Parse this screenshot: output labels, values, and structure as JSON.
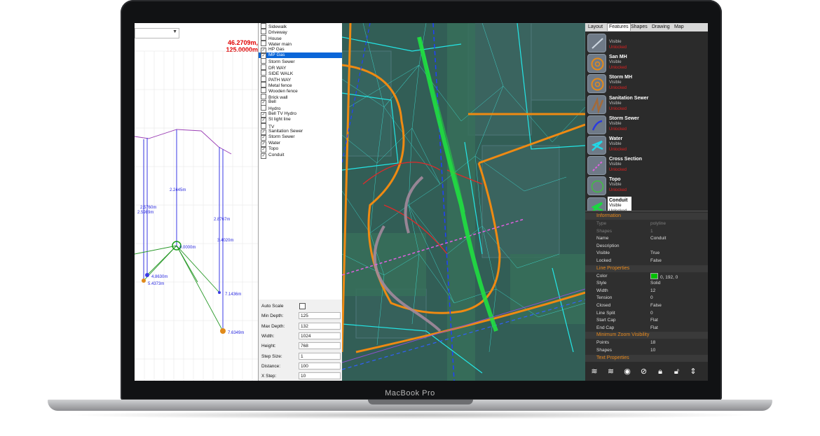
{
  "device": {
    "label": "MacBook Pro"
  },
  "profile": {
    "coords": "46.2709m, 125.0000m",
    "labels": {
      "top_span": "2.2445m",
      "left_a": "2.5760m",
      "left_b": "2.5989m",
      "right_a": "2.8767m",
      "right_b": "3.4020m",
      "center": "0.0000m",
      "low_left_a": "4.8630m",
      "low_left_b": "5.4373m",
      "low_right_a": "7.1436m",
      "low_right_b": "7.6349m"
    }
  },
  "layers": [
    {
      "label": "Sidewalk",
      "checked": false
    },
    {
      "label": "Driveway",
      "checked": false
    },
    {
      "label": "House",
      "checked": false
    },
    {
      "label": "Water main",
      "checked": false
    },
    {
      "label": "HP Gas",
      "checked": true
    },
    {
      "label": "MP Gas",
      "checked": true,
      "selected": true
    },
    {
      "label": "Storm Sewer",
      "checked": false
    },
    {
      "label": "DR WAY",
      "checked": false
    },
    {
      "label": "SIDE WALK",
      "checked": false
    },
    {
      "label": "PATH WAY",
      "checked": false
    },
    {
      "label": "Metal fence",
      "checked": false
    },
    {
      "label": "Wooden fence",
      "checked": false
    },
    {
      "label": "Brick wall",
      "checked": false
    },
    {
      "label": "Bell",
      "checked": true
    },
    {
      "label": "Hydro",
      "checked": false
    },
    {
      "label": "Bell TV Hydro",
      "checked": true
    },
    {
      "label": "St light line",
      "checked": true
    },
    {
      "label": "TV",
      "checked": false
    },
    {
      "label": "Sanitation Sewer",
      "checked": true
    },
    {
      "label": "Storm Sewer",
      "checked": true
    },
    {
      "label": "Water",
      "checked": true
    },
    {
      "label": "Topo",
      "checked": true
    },
    {
      "label": "Conduit",
      "checked": true
    }
  ],
  "params": [
    {
      "label": "Auto Scale",
      "type": "checkbox"
    },
    {
      "label": "Min Depth:",
      "value": "125"
    },
    {
      "label": "Max Depth:",
      "value": "132"
    },
    {
      "label": "Width:",
      "value": "1024"
    },
    {
      "label": "Height:",
      "value": "768"
    },
    {
      "label": "Step Size:",
      "value": "1"
    },
    {
      "label": "Distance:",
      "value": "100"
    },
    {
      "label": "X Step:",
      "value": "10"
    }
  ],
  "tabs": [
    "Layout",
    "Features",
    "Shapes",
    "Drawing",
    "Map"
  ],
  "active_tab": "Features",
  "features": [
    {
      "name": "",
      "visible": "Visible",
      "locked": "Unlocked",
      "icon": "line-feature-icon"
    },
    {
      "name": "San MH",
      "visible": "Visible",
      "locked": "Unlocked",
      "icon": "manhole-icon"
    },
    {
      "name": "Storm MH",
      "visible": "Visible",
      "locked": "Unlocked",
      "icon": "manhole-icon"
    },
    {
      "name": "Sanitation Sewer",
      "visible": "Visible",
      "locked": "Unlocked",
      "icon": "sewer-line-icon"
    },
    {
      "name": "Storm Sewer",
      "visible": "Visible",
      "locked": "Unlocked",
      "icon": "storm-line-icon"
    },
    {
      "name": "Water",
      "visible": "Visible",
      "locked": "Unlocked",
      "icon": "water-line-icon"
    },
    {
      "name": "Cross Section",
      "visible": "Visible",
      "locked": "Unlocked",
      "icon": "cross-section-icon"
    },
    {
      "name": "Topo",
      "visible": "Visible",
      "locked": "Unlocked",
      "icon": "topo-icon"
    },
    {
      "name": "Conduit",
      "visible": "Visible",
      "locked": "Unlocked",
      "icon": "conduit-icon",
      "selected": true
    }
  ],
  "properties": {
    "information_title": "Information",
    "info": [
      {
        "k": "Type",
        "v": "polyline",
        "dim": true
      },
      {
        "k": "Shapes",
        "v": "1",
        "dim": true
      },
      {
        "k": "Name",
        "v": "Conduit"
      },
      {
        "k": "Description",
        "v": ""
      },
      {
        "k": "Visible",
        "v": "True"
      },
      {
        "k": "Locked",
        "v": "False"
      }
    ],
    "line_title": "Line Properties",
    "line": [
      {
        "k": "Color",
        "v": "0, 192, 0",
        "swatch": "#00c000"
      },
      {
        "k": "Style",
        "v": "Solid"
      },
      {
        "k": "Width",
        "v": "12"
      },
      {
        "k": "Tension",
        "v": "0"
      },
      {
        "k": "Closed",
        "v": "False"
      },
      {
        "k": "Line Split",
        "v": "0"
      },
      {
        "k": "Start Cap",
        "v": "Flat"
      },
      {
        "k": "End Cap",
        "v": "Flat"
      }
    ],
    "zoom_title": "Minimum Zoom Visibility",
    "zoom": [
      {
        "k": "Points",
        "v": "18"
      },
      {
        "k": "Shapes",
        "v": "10"
      }
    ],
    "text_title": "Text Properties"
  },
  "toolbar_icons": [
    "layers-up-icon",
    "layers-down-icon",
    "eye-icon",
    "eye-off-icon",
    "lock-icon",
    "unlock-icon",
    "move-vertical-icon"
  ]
}
